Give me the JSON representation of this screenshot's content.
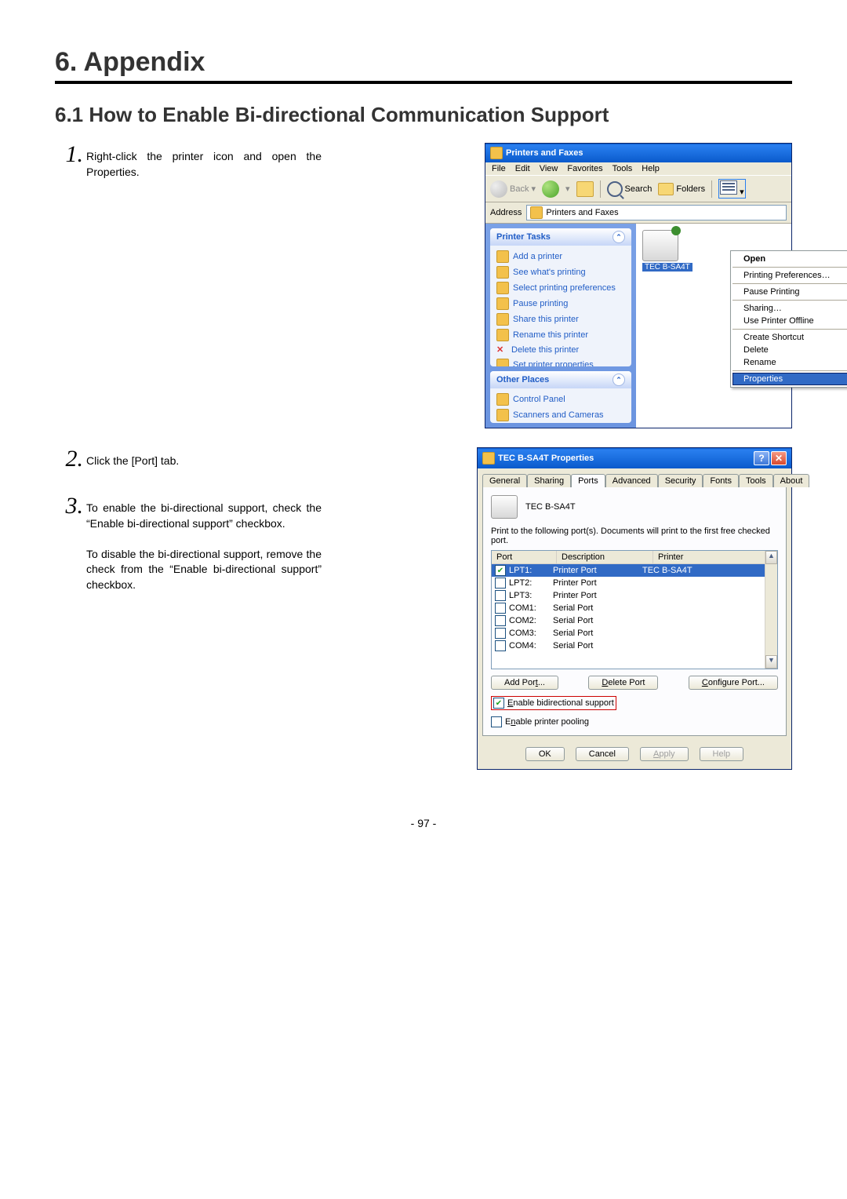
{
  "chapter": "6.  Appendix",
  "section": "6.1  How to Enable Bi-directional Communication Support",
  "page_number": "- 97 -",
  "steps": {
    "s1_num": "1.",
    "s1_text": "Right-click the printer icon and open the Properties.",
    "s2_num": "2.",
    "s2_text": "Click the [Port] tab.",
    "s3_num": "3.",
    "s3_text_a": "To enable the bi-directional support, check the “Enable bi-directional support” checkbox.",
    "s3_text_b": "To disable the bi-directional support, remove the check from the “Enable bi-directional support” checkbox."
  },
  "win1": {
    "title": "Printers and Faxes",
    "menu": {
      "file": "File",
      "edit": "Edit",
      "view": "View",
      "favorites": "Favorites",
      "tools": "Tools",
      "help": "Help"
    },
    "toolbar": {
      "back": "Back",
      "search": "Search",
      "folders": "Folders"
    },
    "address_label": "Address",
    "address_value": "Printers and Faxes",
    "tasks_title": "Printer Tasks",
    "tasks": {
      "add": "Add a printer",
      "whats": "See what's printing",
      "prefs": "Select printing preferences",
      "pause": "Pause printing",
      "share": "Share this printer",
      "rename": "Rename this printer",
      "delete": "Delete this printer",
      "props": "Set printer properties"
    },
    "other_title": "Other Places",
    "other": {
      "cp": "Control Panel",
      "sc": "Scanners and Cameras"
    },
    "printer_label": "TEC B-SA4T",
    "ctx": {
      "open": "Open",
      "prefs": "Printing Preferences…",
      "pause": "Pause Printing",
      "sharing": "Sharing…",
      "offline": "Use Printer Offline",
      "shortcut": "Create Shortcut",
      "delete": "Delete",
      "rename": "Rename",
      "props": "Properties"
    }
  },
  "win2": {
    "title": "TEC B-SA4T Properties",
    "tabs": {
      "general": "General",
      "sharing": "Sharing",
      "ports": "Ports",
      "advanced": "Advanced",
      "security": "Security",
      "fonts": "Fonts",
      "tools": "Tools",
      "about": "About"
    },
    "printer_name": "TEC B-SA4T",
    "instruction": "Print to the following port(s). Documents will print to the first free checked port.",
    "heads": {
      "port": "Port",
      "desc": "Description",
      "printer": "Printer"
    },
    "ports": [
      {
        "checked": true,
        "port": "LPT1:",
        "desc": "Printer Port",
        "printer": "TEC B-SA4T"
      },
      {
        "checked": false,
        "port": "LPT2:",
        "desc": "Printer Port",
        "printer": ""
      },
      {
        "checked": false,
        "port": "LPT3:",
        "desc": "Printer Port",
        "printer": ""
      },
      {
        "checked": false,
        "port": "COM1:",
        "desc": "Serial Port",
        "printer": ""
      },
      {
        "checked": false,
        "port": "COM2:",
        "desc": "Serial Port",
        "printer": ""
      },
      {
        "checked": false,
        "port": "COM3:",
        "desc": "Serial Port",
        "printer": ""
      },
      {
        "checked": false,
        "port": "COM4:",
        "desc": "Serial Port",
        "printer": ""
      }
    ],
    "btns": {
      "add_u": "t",
      "add": "Add Por",
      "add_suf": "...",
      "del_u": "D",
      "del": "elete Port",
      "cfg_u": "C",
      "cfg": "onfigure Port..."
    },
    "chk": {
      "bd_u": "E",
      "bd": "nable bidirectional support",
      "pool_u": "n",
      "pool_pre": "E",
      "pool": "able printer pooling"
    },
    "dlg": {
      "ok": "OK",
      "cancel": "Cancel",
      "apply_u": "A",
      "apply": "pply",
      "help": "Help"
    }
  }
}
